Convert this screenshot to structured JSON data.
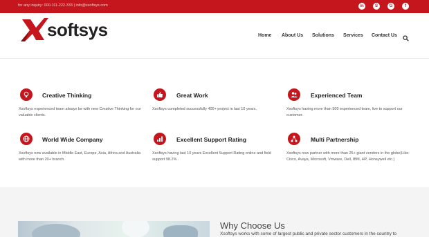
{
  "topbar": {
    "contact": "for any inquiry: 000-111-222-333 | info@xsoftsys.com",
    "social": [
      {
        "icon": "linkedin-icon",
        "glyph": "in"
      },
      {
        "icon": "skype-icon",
        "glyph": "S"
      },
      {
        "icon": "google-plus-icon",
        "glyph": "G"
      },
      {
        "icon": "facebook-icon",
        "glyph": "f"
      }
    ]
  },
  "header": {
    "logo_text": "softsys",
    "nav": [
      "Home",
      "About Us",
      "Solutions",
      "Services",
      "Contact Us"
    ]
  },
  "colors": {
    "brand": "#c4161c",
    "topbar_text": "#f3c9ca",
    "section_bg": "#f4f4f4"
  },
  "features": [
    {
      "icon": "lightbulb-icon",
      "title": "Creative Thinking",
      "desc": "Xsoftsys experienced team always be with new Creative Thinking for our valuable clients."
    },
    {
      "icon": "thumbs-up-icon",
      "title": "Great Work",
      "desc": "Xsoftsys completed successfully 400+ project in last 10 years."
    },
    {
      "icon": "users-icon",
      "title": "Experienced Team",
      "desc": "Xsoftsys having more than 500 experienced team, live to support our customer."
    },
    {
      "icon": "globe-icon",
      "title": "World Wide Company",
      "desc": "Xsoftsys now available in Middle East, Europe, Asia, Africa and Australia with more than 20+ branch."
    },
    {
      "icon": "chart-icon",
      "title": "Excellent Support Rating",
      "desc": "Xsoftsys having last 10 years Excellent Support Rating  online and field support 98.2% ."
    },
    {
      "icon": "network-icon",
      "title": "Multi Partnership",
      "desc": "Xsoftsys now partner with more than 25+ giant vendors in the globe(Like: Cisco, Avaya, Microsoft, Vmware, Dell, IBM, HP, Honeywell etc.)"
    }
  ],
  "why": {
    "title": "Why Choose Us",
    "text": "Xsoftsys works with some of largest public and private sector customers in the country to"
  }
}
